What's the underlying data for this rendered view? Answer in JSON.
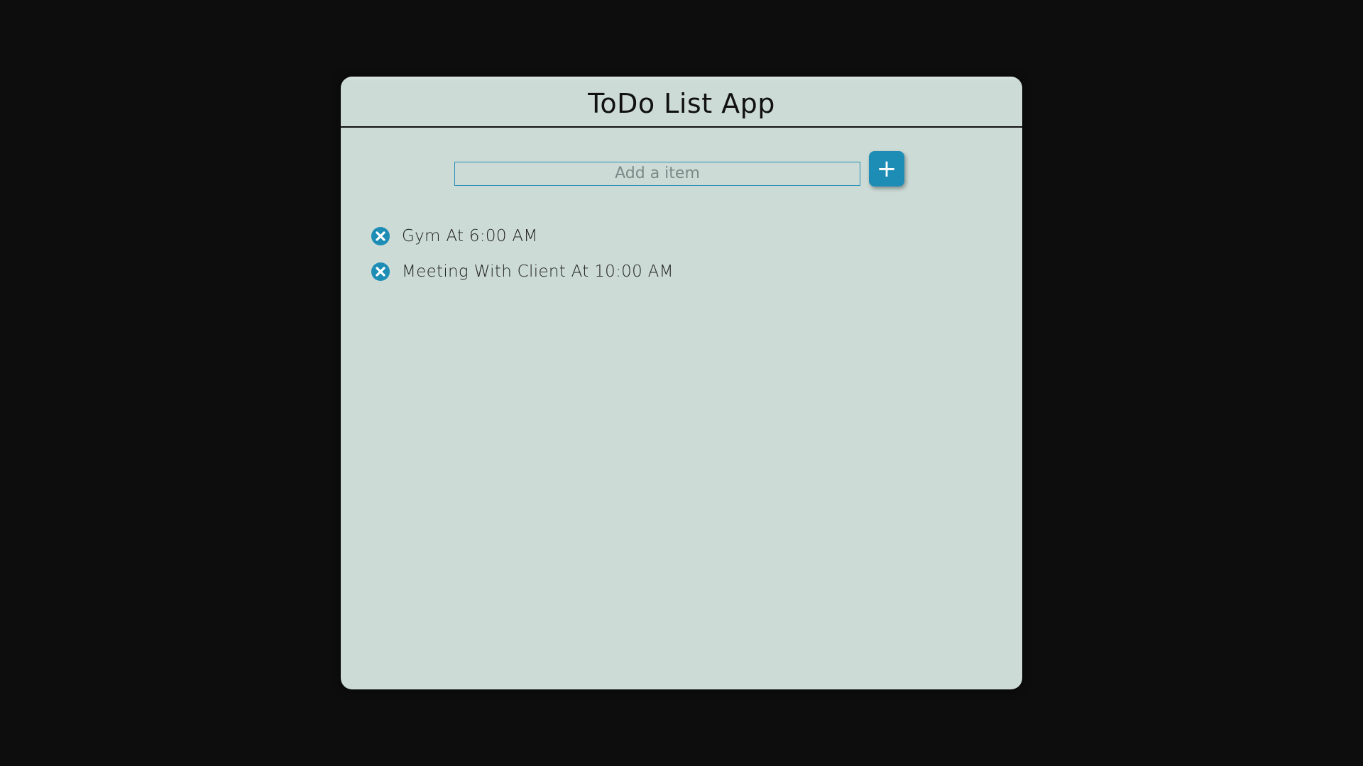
{
  "app": {
    "title": "ToDo List App"
  },
  "input": {
    "placeholder": "Add a item",
    "value": ""
  },
  "add_button": {
    "label": "+",
    "icon": "plus-icon"
  },
  "items": [
    {
      "text": "Gym At 6:00 AM",
      "icon": "close-circle-icon"
    },
    {
      "text": "Meeting With Client At 10:00 AM",
      "icon": "close-circle-icon"
    }
  ],
  "colors": {
    "background": "#0d0d0d",
    "card": "#ccdbd6",
    "accent": "#1e8db6"
  }
}
